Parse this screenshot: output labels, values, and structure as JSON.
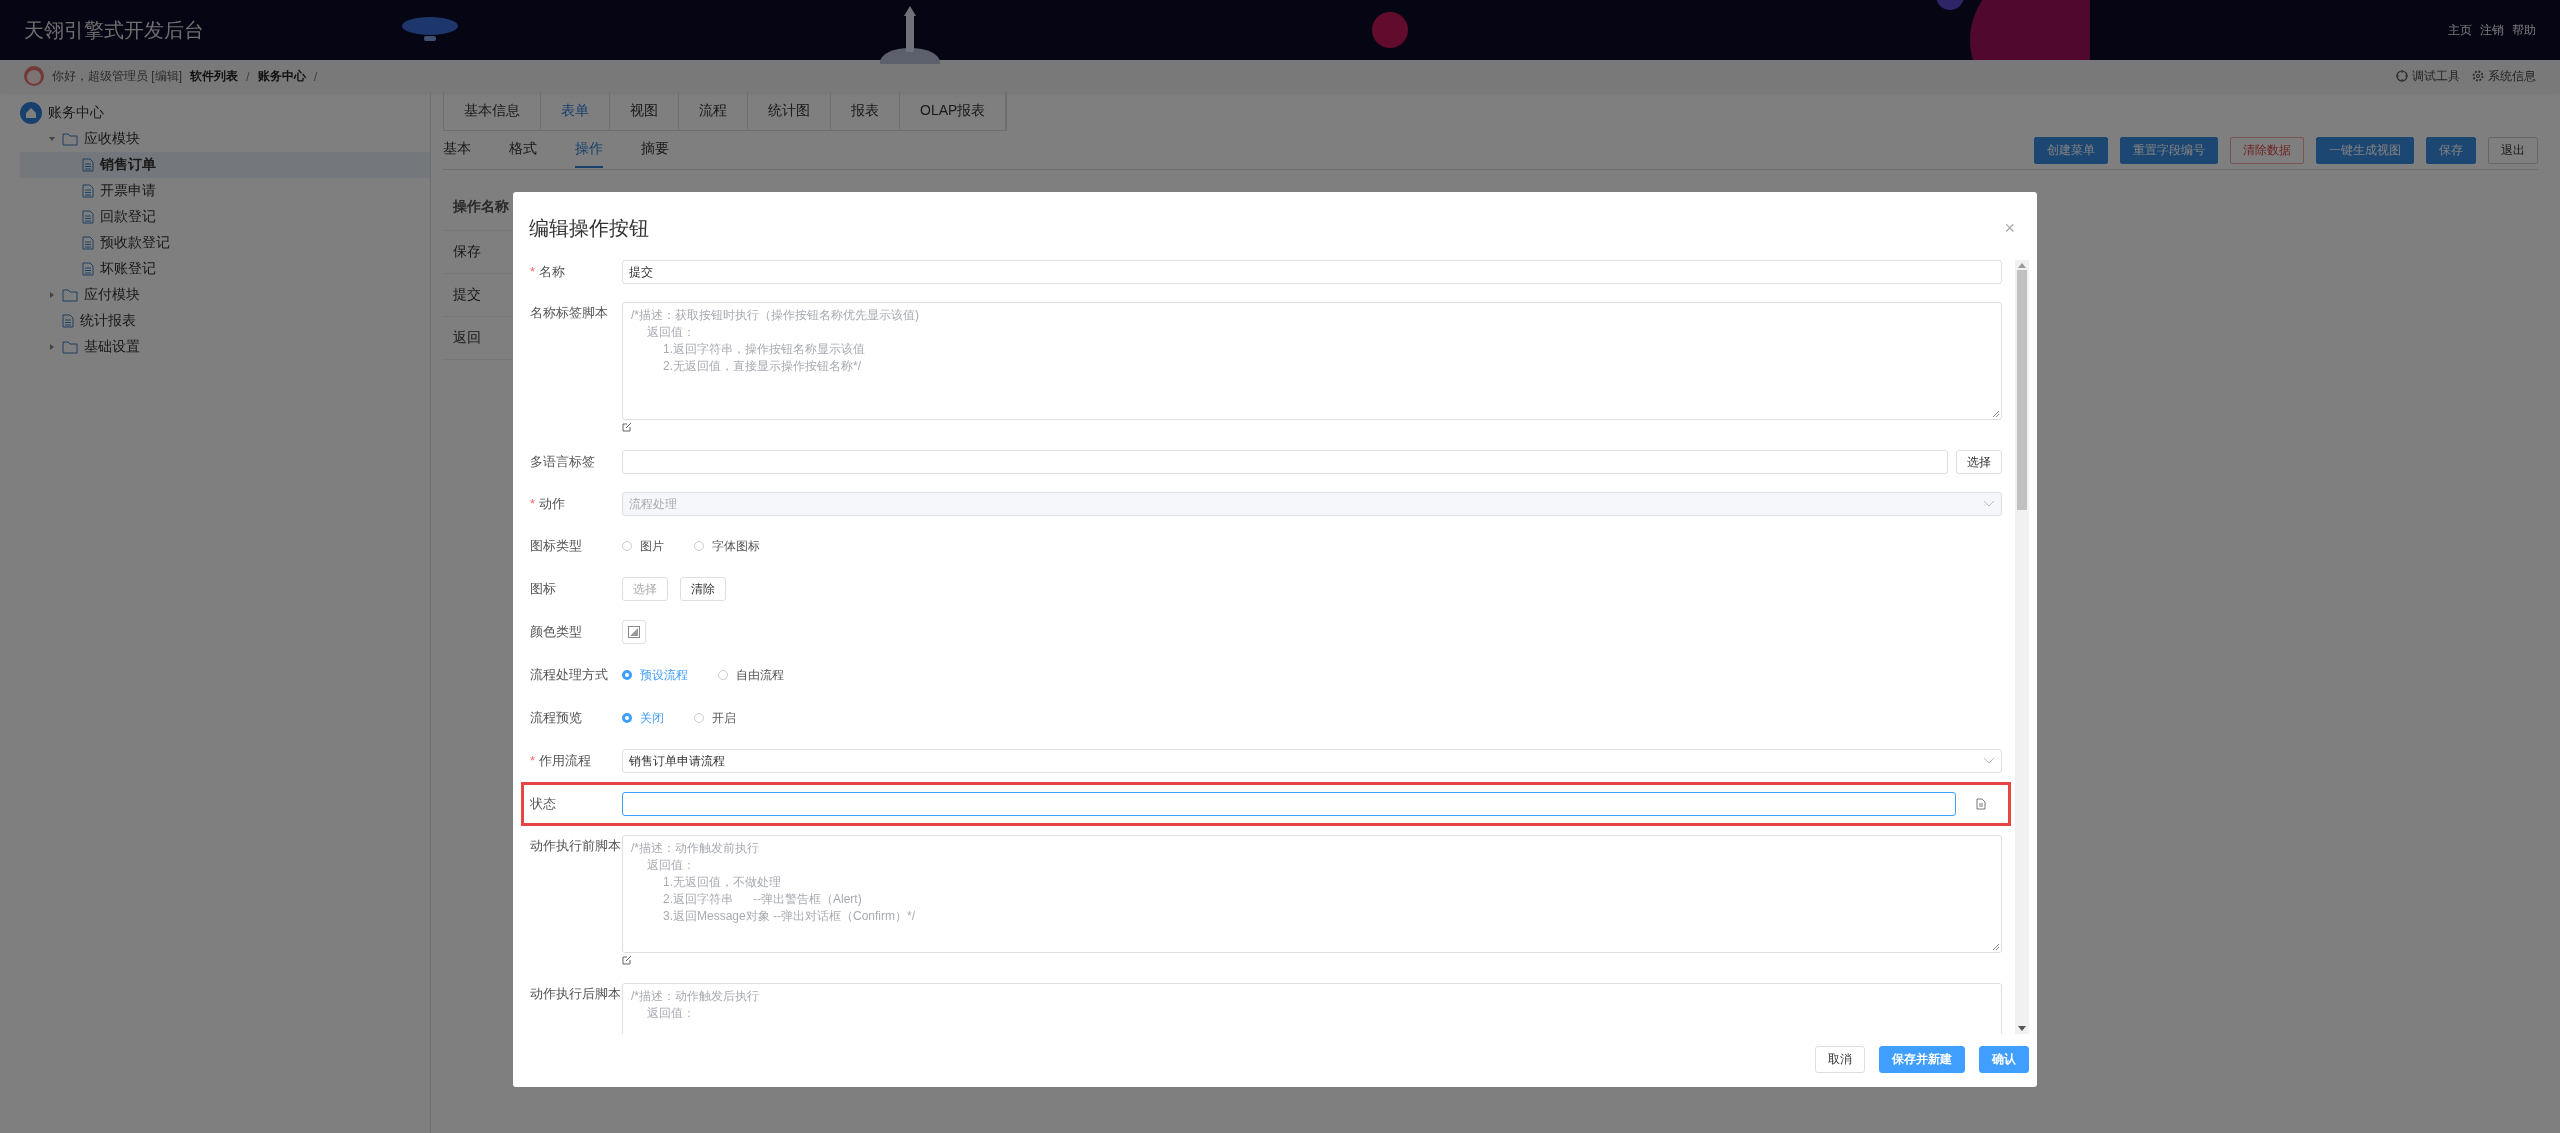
{
  "header": {
    "title": "天翎引擎式开发后台",
    "links": [
      "主页",
      "注销",
      "帮助"
    ]
  },
  "breadcrumb": {
    "greeting": "你好，超级管理员 [编辑]",
    "path": [
      "软件列表",
      "账务中心"
    ],
    "separator": "/",
    "tools": [
      {
        "kind": "debug",
        "label": "调试工具"
      },
      {
        "kind": "settings",
        "label": "系统信息"
      }
    ]
  },
  "sidebar": {
    "root": "账务中心",
    "items": [
      {
        "kind": "folder",
        "label": "应收模块",
        "expanded": true,
        "selected": false,
        "children": [
          {
            "kind": "page",
            "label": "销售订单",
            "selected": true
          },
          {
            "kind": "page",
            "label": "开票申请",
            "selected": false
          },
          {
            "kind": "page",
            "label": "回款登记",
            "selected": false
          },
          {
            "kind": "page",
            "label": "预收款登记",
            "selected": false
          },
          {
            "kind": "page",
            "label": "坏账登记",
            "selected": false
          }
        ]
      },
      {
        "kind": "folder",
        "label": "应付模块",
        "expanded": false,
        "selected": false
      },
      {
        "kind": "page",
        "label": "统计报表",
        "selected": false
      },
      {
        "kind": "folder",
        "label": "基础设置",
        "expanded": false,
        "selected": false
      }
    ]
  },
  "tabs": [
    {
      "label": "基本信息",
      "selected": false
    },
    {
      "label": "表单",
      "selected": true
    },
    {
      "label": "视图",
      "selected": false
    },
    {
      "label": "流程",
      "selected": false
    },
    {
      "label": "统计图",
      "selected": false
    },
    {
      "label": "报表",
      "selected": false
    },
    {
      "label": "OLAP报表",
      "selected": false
    }
  ],
  "subtabs": [
    {
      "label": "基本",
      "selected": false
    },
    {
      "label": "格式",
      "selected": false
    },
    {
      "label": "操作",
      "selected": true
    },
    {
      "label": "摘要",
      "selected": false
    }
  ],
  "actions": [
    {
      "kind": "primary",
      "label": "创建菜单"
    },
    {
      "kind": "primary",
      "label": "重置字段编号"
    },
    {
      "kind": "danger",
      "label": "清除数据"
    },
    {
      "kind": "primary",
      "label": "一键生成视图"
    },
    {
      "kind": "primary",
      "label": "保存"
    },
    {
      "kind": "default",
      "label": "退出"
    }
  ],
  "table": {
    "columns": [
      "操作名称"
    ],
    "rows": [
      "保存",
      "提交",
      "返回"
    ]
  },
  "dialog": {
    "title": "编辑操作按钮",
    "close": "×",
    "fields": [
      {
        "kind": "input",
        "label": "名称",
        "marker": "*",
        "value": "提交",
        "highlighted": false
      },
      {
        "kind": "textarea",
        "label": "名称标签脚本",
        "highlighted": false,
        "placeholder": [
          "/*描述：获取按钮时执行（操作按钮名称优先显示该值)",
          "返回值：",
          "1.返回字符串，操作按钮名称显示该值",
          "2.无返回值，直接显示操作按钮名称*/"
        ]
      },
      {
        "kind": "input-button",
        "label": "多语言标签",
        "highlighted": false,
        "button": "选择"
      },
      {
        "kind": "select",
        "label": "动作",
        "marker": "*",
        "highlighted": false,
        "value": "流程处理",
        "disabled": true
      },
      {
        "kind": "radio",
        "label": "图标类型",
        "highlighted": false,
        "options": [
          {
            "label": "图片",
            "selected": false
          },
          {
            "label": "字体图标",
            "selected": false
          }
        ]
      },
      {
        "kind": "buttons",
        "label": "图标",
        "highlighted": false,
        "buttons": [
          {
            "label": "选择",
            "disabled": true
          },
          {
            "label": "清除",
            "disabled": false
          }
        ]
      },
      {
        "kind": "color",
        "label": "颜色类型",
        "highlighted": false
      },
      {
        "kind": "radio",
        "label": "流程处理方式",
        "highlighted": false,
        "options": [
          {
            "label": "预设流程",
            "selected": true
          },
          {
            "label": "自由流程",
            "selected": false
          }
        ]
      },
      {
        "kind": "radio",
        "label": "流程预览",
        "highlighted": false,
        "options": [
          {
            "label": "关闭",
            "selected": true
          },
          {
            "label": "开启",
            "selected": false
          }
        ]
      },
      {
        "kind": "select",
        "label": "作用流程",
        "marker": "*",
        "highlighted": false,
        "value": "销售订单申请流程",
        "disabled": false
      },
      {
        "kind": "input-icon",
        "label": "状态",
        "highlighted": true
      },
      {
        "kind": "textarea",
        "label": "动作执行前脚本",
        "highlighted": false,
        "placeholder": [
          "/*描述：动作触发前执行",
          "返回值：",
          "1.无返回值，不做处理",
          "2.返回字符串      --弹出警告框（Alert)",
          "3.返回Message对象 --弹出对话框（Confirm）*/"
        ]
      },
      {
        "kind": "textarea",
        "label": "动作执行后脚本",
        "highlighted": false,
        "placeholder": [
          "/*描述：动作触发后执行",
          "返回值："
        ]
      }
    ],
    "footer": [
      {
        "kind": "default",
        "label": "取消"
      },
      {
        "kind": "primary",
        "label": "保存并新建"
      },
      {
        "kind": "primary",
        "label": "确认"
      }
    ]
  }
}
